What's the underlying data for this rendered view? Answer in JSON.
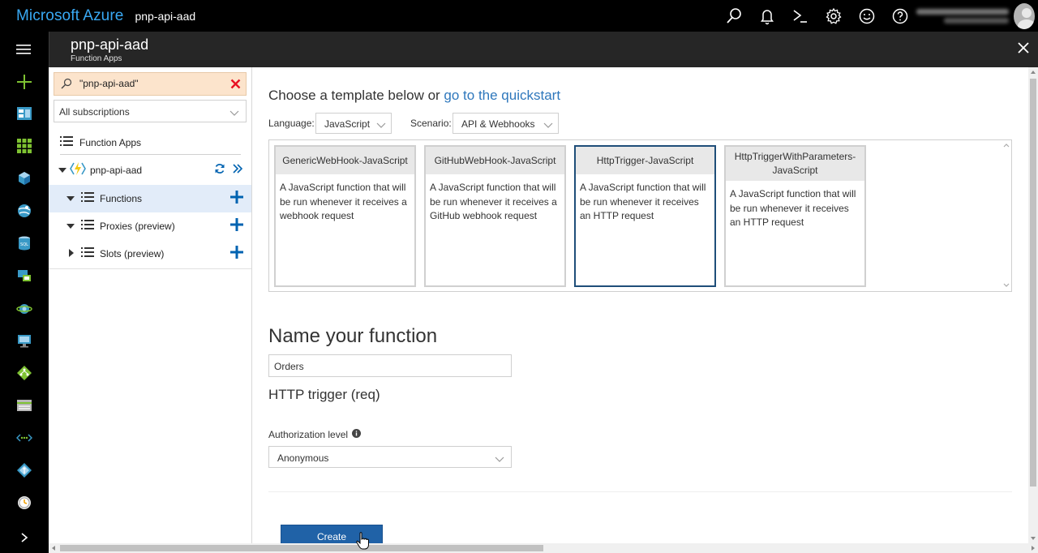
{
  "topbar": {
    "brand": "Microsoft Azure",
    "resource_title": "pnp-api-aad",
    "icons": [
      "search-icon",
      "notifications-bell-icon",
      "cloud-shell-icon",
      "settings-gear-icon",
      "feedback-smiley-icon",
      "help-icon"
    ]
  },
  "rail": {
    "items": [
      "hamburger-menu-icon",
      "new-plus-icon",
      "dashboard-icon",
      "all-resources-icon",
      "resource-groups-icon",
      "app-services-icon",
      "sql-databases-icon",
      "virtual-machines-classic-icon",
      "cloud-services-icon",
      "virtual-machines-icon",
      "load-balancers-icon",
      "storage-accounts-icon",
      "virtual-networks-icon",
      "azure-active-directory-icon",
      "monitor-icon",
      "expand-chevron-icon"
    ]
  },
  "blade": {
    "title": "pnp-api-aad",
    "subtitle": "Function Apps"
  },
  "tree": {
    "search_value": "\"pnp-api-aad\"",
    "subscription": "All subscriptions",
    "function_apps_label": "Function Apps",
    "app_name": "pnp-api-aad",
    "nodes": [
      {
        "label": "Functions"
      },
      {
        "label": "Proxies (preview)"
      },
      {
        "label": "Slots (preview)"
      }
    ]
  },
  "main": {
    "choose_prefix": "Choose a template below or",
    "quickstart_link": "go to the quickstart",
    "language_label": "Language:",
    "language_value": "JavaScript",
    "scenario_label": "Scenario:",
    "scenario_value": "API & Webhooks",
    "templates": [
      {
        "title": "GenericWebHook-JavaScript",
        "desc": "A JavaScript function that will be run whenever it receives a webhook request"
      },
      {
        "title": "GitHubWebHook-JavaScript",
        "desc": "A JavaScript function that will be run whenever it receives a GitHub webhook request"
      },
      {
        "title": "HttpTrigger-JavaScript",
        "desc": "A JavaScript function that will be run whenever it receives an HTTP request"
      },
      {
        "title": "HttpTriggerWithParameters-JavaScript",
        "desc": "A JavaScript function that will be run whenever it receives an HTTP request"
      }
    ],
    "selected_template": "HttpTrigger-JavaScript",
    "name_heading": "Name your function",
    "name_value": "Orders",
    "trigger_heading": "HTTP trigger (req)",
    "auth_label": "Authorization level",
    "auth_value": "Anonymous",
    "create_label": "Create"
  },
  "colors": {
    "brand": "#39a9f4",
    "link": "#2e77bc",
    "primary_button": "#2062a7",
    "selected_row": "#e2ecf9",
    "search_highlight": "#fce4cc",
    "clear_red": "#e81123",
    "plus_blue": "#0063b1"
  }
}
